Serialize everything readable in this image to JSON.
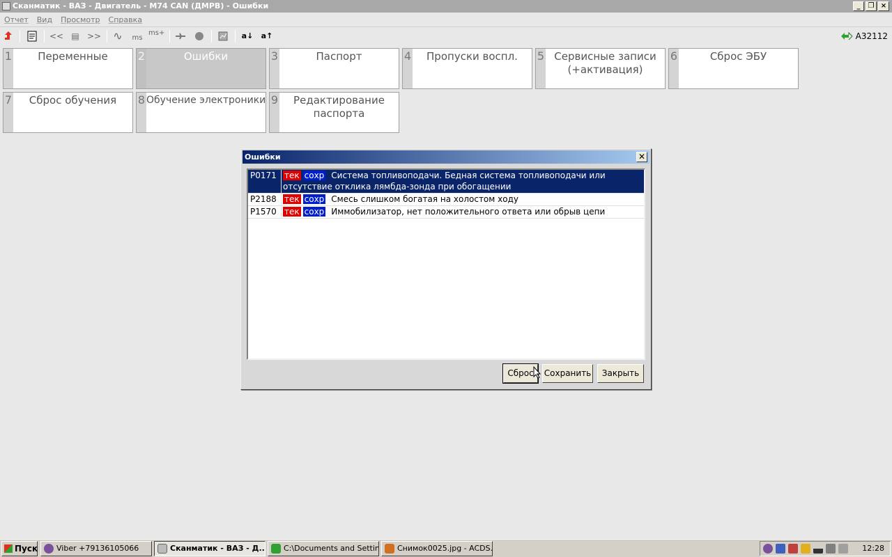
{
  "window": {
    "title": "Сканматик - ВАЗ - Двигатель - M74 CAN (ДМРВ) - Ошибки"
  },
  "menu": [
    "Отчет",
    "Вид",
    "Просмотр",
    "Справка"
  ],
  "toolbar": {
    "prev_label": "<<",
    "list_label": "▤",
    "next_label": ">>",
    "wave_label": "∿",
    "ms_label": "ms",
    "msplus_label": "ms+",
    "font_dec_label": "a↓",
    "font_inc_label": "a↑",
    "device_label": "A32112"
  },
  "tiles": [
    {
      "num": "1",
      "label": "Переменные"
    },
    {
      "num": "2",
      "label": "Ошибки"
    },
    {
      "num": "3",
      "label": "Паспорт"
    },
    {
      "num": "4",
      "label": "Пропуски воспл."
    },
    {
      "num": "5",
      "label": "Сервисные записи (+активация)"
    },
    {
      "num": "6",
      "label": "Сброс ЭБУ"
    },
    {
      "num": "7",
      "label": "Сброс обучения"
    },
    {
      "num": "8",
      "label": "Обучение электроники"
    },
    {
      "num": "9",
      "label": "Редактирование паспорта"
    }
  ],
  "dialog": {
    "title": "Ошибки",
    "close_label": "✕",
    "errors": [
      {
        "code": "P0171",
        "current": "тек",
        "saved": "сохр",
        "text": "Система топливоподачи. Бедная система топливоподачи или отсутствие отклика лямбда-зонда при обогащении"
      },
      {
        "code": "P2188",
        "current": "тек",
        "saved": "сохр",
        "text": "Смесь слишком богатая на холостом ходу"
      },
      {
        "code": "P1570",
        "current": "тек",
        "saved": "сохр",
        "text": "Иммобилизатор, нет положительного ответа или обрыв цепи"
      }
    ],
    "buttons": {
      "reset": "Сброс",
      "save": "Сохранить",
      "close": "Закрыть"
    }
  },
  "taskbar": {
    "start": "Пуск",
    "tasks": [
      "Viber +79136105066",
      "Сканматик - ВАЗ - Д...",
      "C:\\Documents and Settin...",
      "Снимок0025.jpg - ACDS..."
    ],
    "clock": "12:28"
  }
}
